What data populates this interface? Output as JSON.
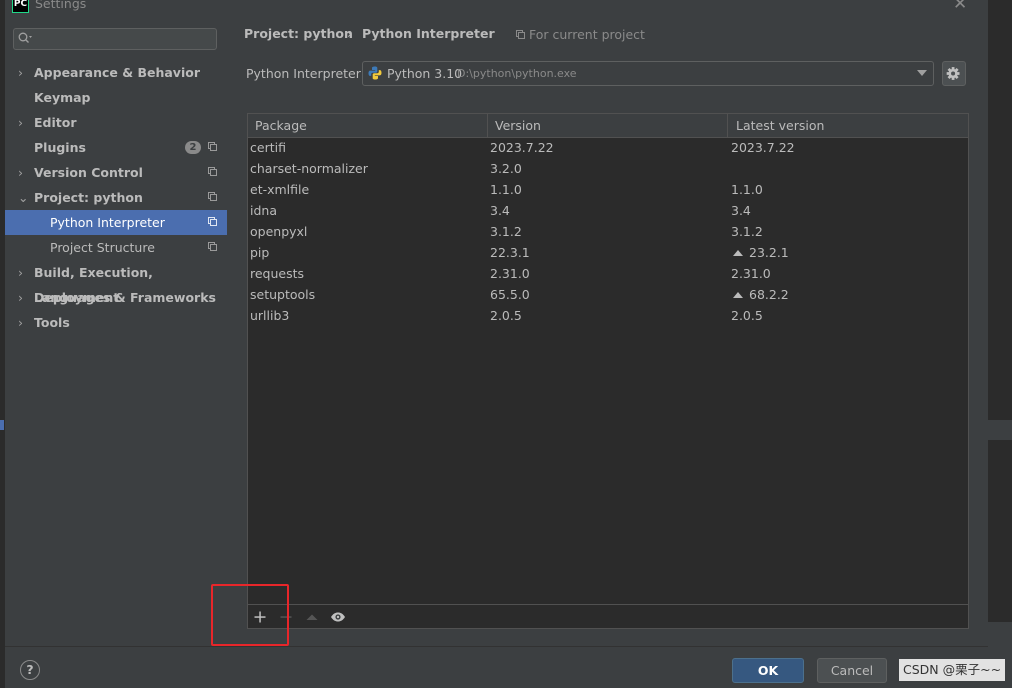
{
  "window": {
    "title": "Settings",
    "app_logo": "PC"
  },
  "sidebar": {
    "search_placeholder": "",
    "items": [
      {
        "label": "Appearance & Behavior",
        "chevron": "›"
      },
      {
        "label": "Keymap"
      },
      {
        "label": "Editor",
        "chevron": "›"
      },
      {
        "label": "Plugins",
        "badge": "2"
      },
      {
        "label": "Version Control",
        "chevron": "›"
      },
      {
        "label": "Project: python",
        "chevron": "⌄"
      },
      {
        "label": "Python Interpreter"
      },
      {
        "label": "Project Structure"
      },
      {
        "label": "Build, Execution, Deployment",
        "chevron": "›"
      },
      {
        "label": "Languages & Frameworks",
        "chevron": "›"
      },
      {
        "label": "Tools",
        "chevron": "›"
      }
    ]
  },
  "breadcrumb": {
    "project": "Project: python",
    "separator": "›",
    "page": "Python Interpreter",
    "note": "For current project"
  },
  "interpreter": {
    "label": "Python Interpreter:",
    "name": "Python 3.10",
    "path": "D:\\python\\python.exe"
  },
  "packages": {
    "columns": [
      "Package",
      "Version",
      "Latest version"
    ],
    "rows": [
      {
        "name": "certifi",
        "version": "2023.7.22",
        "latest": "2023.7.22",
        "upgrade": false
      },
      {
        "name": "charset-normalizer",
        "version": "3.2.0",
        "latest": "",
        "upgrade": false
      },
      {
        "name": "et-xmlfile",
        "version": "1.1.0",
        "latest": "1.1.0",
        "upgrade": false
      },
      {
        "name": "idna",
        "version": "3.4",
        "latest": "3.4",
        "upgrade": false
      },
      {
        "name": "openpyxl",
        "version": "3.1.2",
        "latest": "3.1.2",
        "upgrade": false
      },
      {
        "name": "pip",
        "version": "22.3.1",
        "latest": "23.2.1",
        "upgrade": true
      },
      {
        "name": "requests",
        "version": "2.31.0",
        "latest": "2.31.0",
        "upgrade": false
      },
      {
        "name": "setuptools",
        "version": "65.5.0",
        "latest": "68.2.2",
        "upgrade": true
      },
      {
        "name": "urllib3",
        "version": "2.0.5",
        "latest": "2.0.5",
        "upgrade": false
      }
    ]
  },
  "toolbar": {
    "icons": [
      "plus-icon",
      "minus-icon",
      "upgrade-icon",
      "eye-icon"
    ]
  },
  "footer": {
    "help": "?",
    "ok": "OK",
    "cancel": "Cancel"
  },
  "watermark": "CSDN @栗子~~",
  "colors": {
    "accent": "#4b6eaf",
    "background": "#3c3f41",
    "table_bg": "#2b2b2b",
    "ok_button": "#365880",
    "highlight_box": "#e8262a"
  }
}
